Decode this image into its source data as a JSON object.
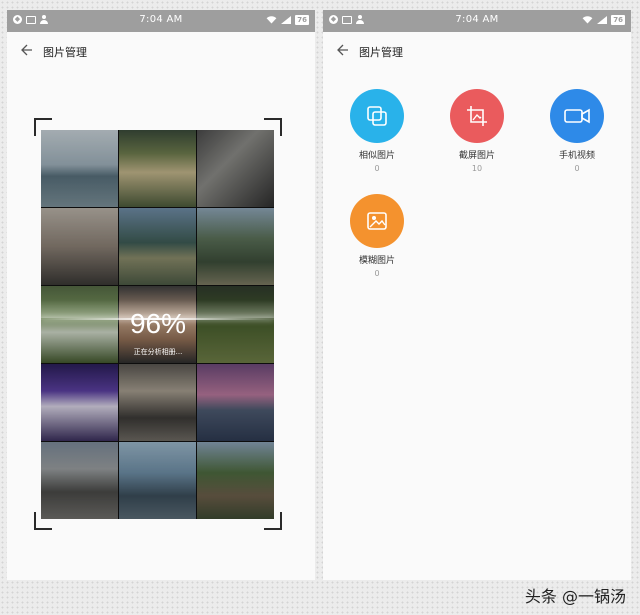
{
  "status_bar": {
    "time": "7:04 AM",
    "battery": "76"
  },
  "left_screen": {
    "title": "图片管理",
    "progress_percent": "96%",
    "progress_status": "正在分析相册..."
  },
  "right_screen": {
    "title": "图片管理",
    "categories": [
      {
        "label": "相似图片",
        "count": "0",
        "icon": "similar-photos-icon",
        "color": "#29b2ea"
      },
      {
        "label": "截屏图片",
        "count": "10",
        "icon": "screenshot-icon",
        "color": "#ea5b5d"
      },
      {
        "label": "手机视频",
        "count": "0",
        "icon": "video-icon",
        "color": "#2e8ae8"
      },
      {
        "label": "模糊图片",
        "count": "0",
        "icon": "blurry-photo-icon",
        "color": "#f4922e"
      }
    ]
  },
  "watermark": "头条 @一锅汤"
}
